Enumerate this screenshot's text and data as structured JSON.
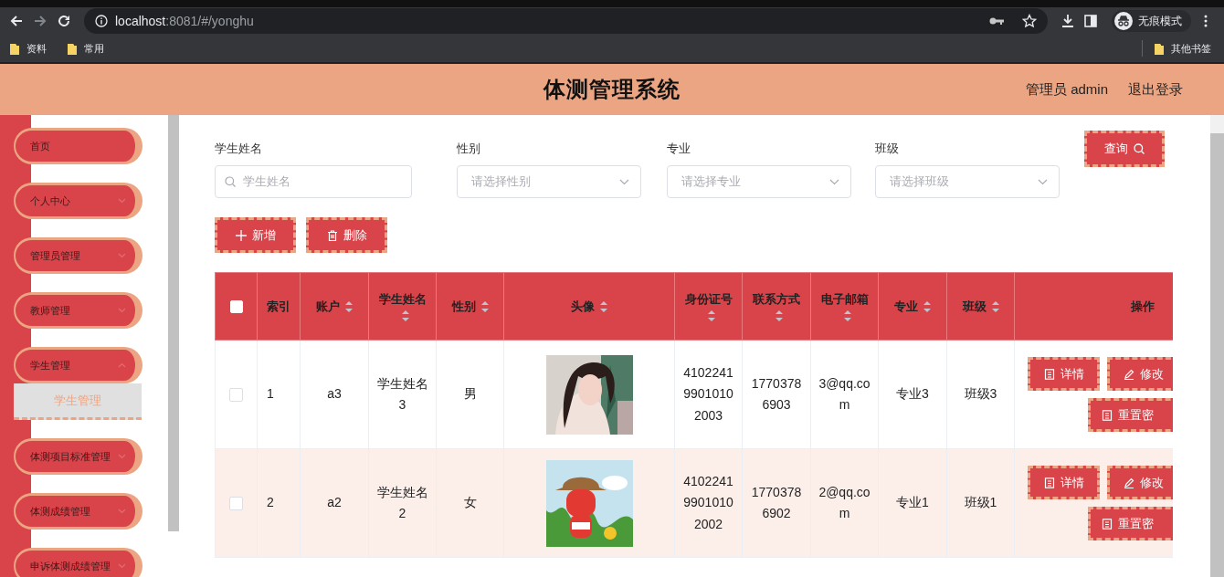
{
  "browser": {
    "url_host": "localhost",
    "url_path": ":8081/#/yonghu",
    "profile_label": "无痕模式",
    "bookmarks": [
      "资料",
      "常用"
    ],
    "other_bookmarks": "其他书签"
  },
  "header": {
    "title": "体测管理系统",
    "user": "管理员 admin",
    "logout": "退出登录"
  },
  "sidebar": {
    "items": [
      {
        "label": "首页",
        "kind": "link"
      },
      {
        "label": "个人中心",
        "kind": "submenu",
        "expanded": false
      },
      {
        "label": "管理员管理",
        "kind": "submenu",
        "expanded": false
      },
      {
        "label": "教师管理",
        "kind": "submenu",
        "expanded": false
      },
      {
        "label": "学生管理",
        "kind": "submenu",
        "expanded": true,
        "children": [
          {
            "label": "学生管理",
            "selected": true
          }
        ]
      },
      {
        "label": "体测项目标准管理",
        "kind": "submenu",
        "expanded": false
      },
      {
        "label": "体测成绩管理",
        "kind": "submenu",
        "expanded": false
      },
      {
        "label": "申诉体测成绩管理",
        "kind": "submenu",
        "expanded": false
      }
    ]
  },
  "filters": [
    {
      "label": "学生姓名",
      "kind": "text",
      "placeholder": "学生姓名"
    },
    {
      "label": "性别",
      "kind": "select",
      "placeholder": "请选择性别"
    },
    {
      "label": "专业",
      "kind": "select",
      "placeholder": "请选择专业"
    },
    {
      "label": "班级",
      "kind": "select",
      "placeholder": "请选择班级"
    }
  ],
  "search_button": "查询",
  "actions": [
    {
      "label": "新增",
      "kind": "add"
    },
    {
      "label": "删除",
      "kind": "delete"
    }
  ],
  "table": {
    "select_all": {
      "checked": false
    },
    "columns": [
      {
        "label": "索引",
        "kind": "index",
        "sortable": false
      },
      {
        "label": "账户",
        "sortable": true
      },
      {
        "label": "学生姓名",
        "sortable": true
      },
      {
        "label": "性别",
        "sortable": true
      },
      {
        "label": "头像",
        "sortable": true
      },
      {
        "label": "身份证号",
        "sortable": true
      },
      {
        "label": "联系方式",
        "sortable": true
      },
      {
        "label": "电子邮箱",
        "sortable": true
      },
      {
        "label": "专业",
        "sortable": true
      },
      {
        "label": "班级",
        "sortable": true
      },
      {
        "label": "操作",
        "sortable": false
      }
    ],
    "rows": [
      {
        "checked": false,
        "hovered": false,
        "cells": [
          "1",
          "a3",
          "学生姓名3",
          "男",
          {
            "kind": "picture"
          },
          "410224199010102003",
          "17703786903",
          "3@qq.com",
          "专业3",
          "班级3"
        ],
        "actions": [
          {
            "label": "详情",
            "kind": "detail"
          },
          {
            "label": "修改",
            "kind": "edit"
          },
          {
            "label": "重置密",
            "kind": "reset"
          }
        ]
      },
      {
        "checked": false,
        "hovered": true,
        "cells": [
          "2",
          "a2",
          "学生姓名2",
          "女",
          {
            "kind": "picture"
          },
          "410224199010102002",
          "17703786902",
          "2@qq.com",
          "专业1",
          "班级1"
        ],
        "actions": [
          {
            "label": "详情",
            "kind": "detail"
          },
          {
            "label": "修改",
            "kind": "edit"
          },
          {
            "label": "重置密",
            "kind": "reset"
          }
        ]
      }
    ]
  }
}
